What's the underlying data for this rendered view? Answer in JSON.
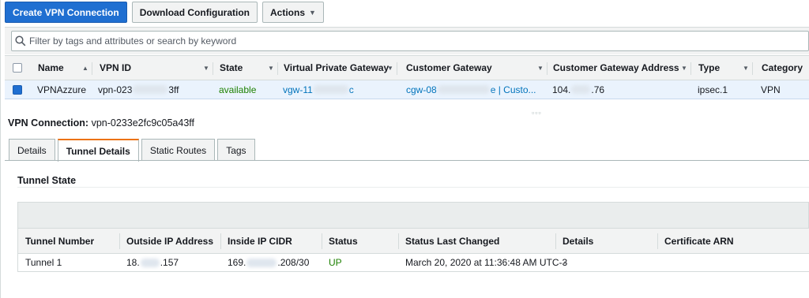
{
  "toolbar": {
    "create_label": "Create VPN Connection",
    "download_label": "Download Configuration",
    "actions_label": "Actions",
    "actions_caret": "▼"
  },
  "search": {
    "placeholder": "Filter by tags and attributes or search by keyword",
    "value": ""
  },
  "table": {
    "columns": [
      "Name",
      "VPN ID",
      "State",
      "Virtual Private Gateway",
      "Customer Gateway",
      "Customer Gateway Address",
      "Type",
      "Category"
    ],
    "row": {
      "name": "VPNAzzure",
      "vpn_id_prefix": "vpn-023",
      "vpn_id_suffix": "3ff",
      "state": "available",
      "vgw_prefix": "vgw-11",
      "vgw_suffix": "c",
      "cgw_prefix": "cgw-08",
      "cgw_suffix": "e | Custo...",
      "cgw_addr_prefix": "104.",
      "cgw_addr_suffix": ".76",
      "type": "ipsec.1",
      "category": "VPN"
    }
  },
  "detail": {
    "label": "VPN Connection:",
    "id": "vpn-0233e2fc9c05a43ff",
    "tabs": [
      "Details",
      "Tunnel Details",
      "Static Routes",
      "Tags"
    ],
    "active_tab": "Tunnel Details",
    "section_title": "Tunnel State"
  },
  "tunnels": {
    "columns": [
      "Tunnel Number",
      "Outside IP Address",
      "Inside IP CIDR",
      "Status",
      "Status Last Changed",
      "Details",
      "Certificate ARN"
    ],
    "row": {
      "number": "Tunnel 1",
      "outside_prefix": "18.",
      "outside_suffix": ".157",
      "inside_prefix": "169.",
      "inside_suffix": ".208/30",
      "status": "UP",
      "changed": "March 20, 2020 at 11:36:48 AM UTC-3",
      "details": "-",
      "cert": ""
    }
  },
  "colors": {
    "primary": "#1f6fd1",
    "status_green": "#1d8102",
    "link": "#0073bb",
    "active_tab_accent": "#ec7211"
  },
  "icons": [
    "search-icon",
    "sort-asc-icon",
    "sort-caret-icon",
    "caret-down-icon",
    "resize-handle-icon"
  ]
}
